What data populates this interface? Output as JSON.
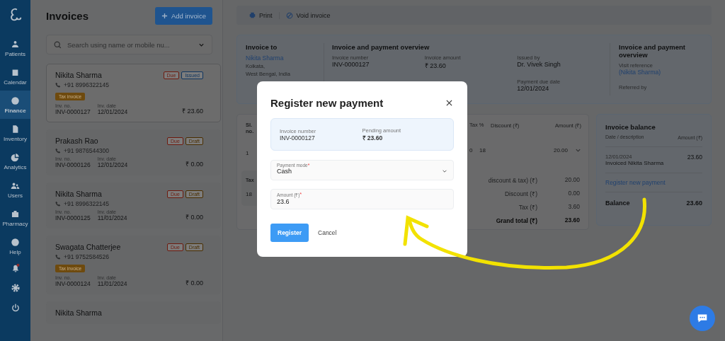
{
  "sidebar": {
    "items": [
      {
        "label": "Patients",
        "selected": false
      },
      {
        "label": "Calendar",
        "selected": false
      },
      {
        "label": "Finance",
        "selected": true
      },
      {
        "label": "Inventory",
        "selected": false
      },
      {
        "label": "Analytics",
        "selected": false
      },
      {
        "label": "Users",
        "selected": false
      },
      {
        "label": "Pharmacy",
        "selected": false
      },
      {
        "label": "Help",
        "selected": false
      }
    ]
  },
  "invoices": {
    "title": "Invoices",
    "add_button": "Add invoice",
    "search": {
      "placeholder": "Search using name or mobile nu..."
    },
    "cards": [
      {
        "name": "Nikita Sharma",
        "phone": "+91 8996322145",
        "selected": true,
        "badges": [
          {
            "label": "Due",
            "color": "#6e1a0e"
          },
          {
            "label": "Issued",
            "color": "#0f3560"
          }
        ],
        "tag": "Tax invoice",
        "no_label": "Inv. no.",
        "inv_no": "INV-0000127",
        "date_label": "Inv. date",
        "inv_date": "12/01/2024",
        "amount": "₹ 23.60"
      },
      {
        "name": "Prakash Rao",
        "phone": "+91 9876544300",
        "selected": false,
        "badges": [
          {
            "label": "Due",
            "color": "#6e1a0e"
          },
          {
            "label": "Draft",
            "color": "#4a2e00"
          }
        ],
        "no_label": "Inv. no.",
        "inv_no": "INV-0000126",
        "date_label": "Inv. date",
        "inv_date": "12/01/2024",
        "amount": "₹ 0.00"
      },
      {
        "name": "Nikita Sharma",
        "phone": "+91 8996322145",
        "selected": false,
        "badges": [
          {
            "label": "Due",
            "color": "#6e1a0e"
          },
          {
            "label": "Draft",
            "color": "#4a2e00"
          }
        ],
        "no_label": "Inv. no.",
        "inv_no": "INV-0000125",
        "date_label": "Inv. date",
        "inv_date": "11/01/2024",
        "amount": "₹ 0.00"
      },
      {
        "name": "Swagata Chatterjee",
        "phone": "+91 9752584526",
        "selected": false,
        "badges": [
          {
            "label": "Due",
            "color": "#6e1a0e"
          },
          {
            "label": "Draft",
            "color": "#4a2e00"
          }
        ],
        "tag": "Tax invoice",
        "no_label": "Inv. no.",
        "inv_no": "INV-0000124",
        "date_label": "Inv. date",
        "inv_date": "11/01/2024",
        "amount": "₹ 0.00"
      },
      {
        "name": "Nikita Sharma",
        "selected": false
      }
    ]
  },
  "toolbar": {
    "print": "Print",
    "void": "Void invoice"
  },
  "info": {
    "invoice_to": {
      "title": "Invoice to",
      "name": "Nikita Sharma",
      "lines": [
        "Kolkata,",
        "West Bengal, India"
      ]
    },
    "overview": {
      "title": "Invoice and payment overview",
      "fields": [
        {
          "label": "Invoice number",
          "value": "INV-0000127"
        },
        {
          "label": "Invoice amount",
          "value": "₹ 23.60"
        },
        {
          "label": "Issued by",
          "value": "Dr. Vivek Singh"
        }
      ],
      "due": {
        "label": "Payment due date",
        "value": "12/01/2024"
      }
    },
    "reference": {
      "title": "Invoice and payment overview",
      "visit_label": "Visit reference",
      "visit_value": "(Nikita Sharma)",
      "referred_label": "Referred by"
    }
  },
  "items": {
    "left": {
      "header": "Sl. no.",
      "row": "1",
      "sub_header": "Tax",
      "sub_row": "18"
    },
    "right": {
      "headers": [
        "Tax %",
        "Discount (₹)",
        "Amount (₹)"
      ],
      "row": [
        "0",
        "18",
        "20.00"
      ],
      "totals": [
        {
          "label": "discount & tax) (₹)",
          "value": "20.00",
          "bold": false
        },
        {
          "label": "Discount (₹)",
          "value": "0.00",
          "bold": false
        },
        {
          "label": "Tax (₹)",
          "value": "3.60",
          "bold": false
        },
        {
          "label": "Grand total (₹)",
          "value": "23.60",
          "bold": true
        }
      ]
    }
  },
  "balance": {
    "title": "Invoice balance",
    "headers": [
      "Date / description",
      "Amount (₹)"
    ],
    "entry": {
      "date": "12/01/2024",
      "description": "Invoiced Nikita Sharma",
      "amount": "23.60"
    },
    "link": "Register new payment",
    "total_label": "Balance",
    "total": "23.60"
  },
  "modal": {
    "title": "Register new payment",
    "summary": [
      {
        "label": "Invoice number",
        "value": "INV-0000127",
        "bold": false
      },
      {
        "label": "Pending amount",
        "value": "₹ 23.60",
        "bold": true
      }
    ],
    "fields": [
      {
        "kind": "select",
        "label": "Payment mode",
        "required": true,
        "required_mark": "*",
        "value": "Cash"
      },
      {
        "kind": "input",
        "label": "Amount (₹)",
        "required": true,
        "required_mark": "*",
        "value": "23.6"
      }
    ],
    "buttons": {
      "primary": "Register",
      "secondary": "Cancel"
    }
  }
}
